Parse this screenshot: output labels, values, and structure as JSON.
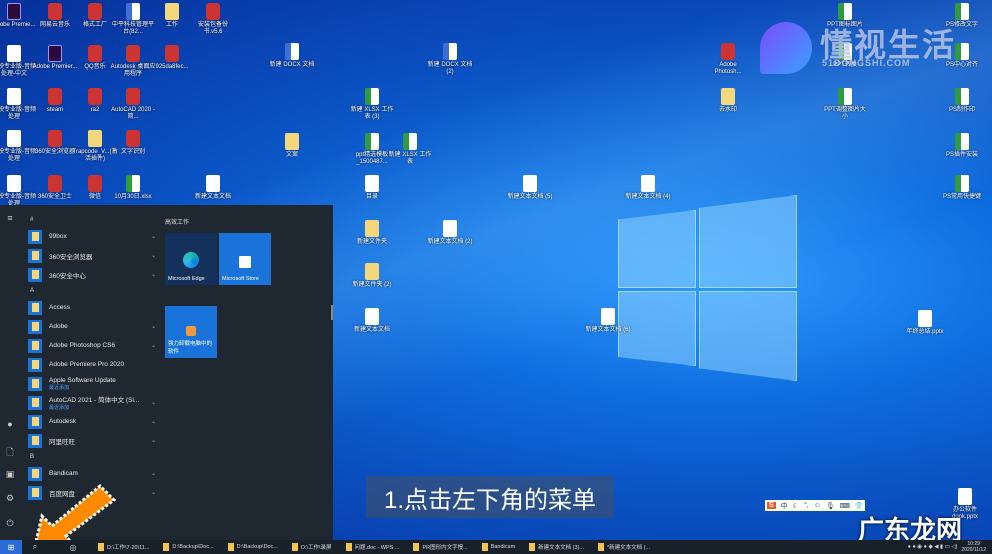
{
  "desktop": {
    "icons": [
      "Adobe Premie...",
      "网易云音乐",
      "格式工厂",
      "中平科技管理平台(82...",
      "工作",
      "安装包备份书.v5.6",
      "剪映专业版-音频处理-中文",
      "Adobe Premier...",
      "QQ音乐",
      "Autodesk 桌面应用程序",
      "925da8fec...",
      "剪映专业版-音频处理",
      "steam",
      "ra2",
      "AutoCAD 2020 - 简...",
      "剪映专业版-音频处理",
      "360安全浏览器",
      "Trapcode_V...(激活插件)",
      "文字识别",
      "剪映专业版-音频处理",
      "360安全卫士",
      "微信",
      "10月30日.xlsx",
      "新建文本文档",
      "新建 DOCX 文档",
      "新建 DOCX 文档 (2)",
      "新建 XLSX 工作表 (3)",
      "文案",
      "ppt精选模板_1500487...",
      "新建 XLSX 工作表",
      "目录",
      "新建文本文档 (5)",
      "新建文本文档 (4)",
      "新建文件夹",
      "新建文本文档 (2)",
      "新建文件夹 (2)",
      "新建文本文档",
      "新建文本文档 (6)",
      "Adobe Photosh...",
      "去水印",
      "PPT图标图片",
      "PPT转换",
      "PPT调整图片大小",
      "PS修改文字",
      "PS中心对齐",
      "PS制作印",
      "PS插件安装",
      "PS常用快捷键",
      "年终总结.pptx",
      "办公软件 dook.pptx"
    ]
  },
  "start_menu": {
    "groups": [
      {
        "header": "#",
        "items": [
          {
            "label": "99box",
            "chev": true
          },
          {
            "label": "360安全浏览器",
            "chev": true
          },
          {
            "label": "360安全中心",
            "chev": true
          }
        ]
      },
      {
        "header": "A",
        "items": [
          {
            "label": "Access"
          },
          {
            "label": "Adobe",
            "chev": true
          },
          {
            "label": "Adobe Photoshop CS6",
            "chev": true
          },
          {
            "label": "Adobe Premiere Pro 2020"
          },
          {
            "label": "Apple Software Update",
            "sub": "最近添加"
          },
          {
            "label": "AutoCAD 2021 - 简体中文 (Si...",
            "sub": "最近添加",
            "chev": true
          },
          {
            "label": "Autodesk",
            "chev": true
          },
          {
            "label": "阿里旺旺",
            "chev": true
          }
        ]
      },
      {
        "header": "B",
        "items": [
          {
            "label": "Bandicam",
            "chev": true
          },
          {
            "label": "百度网盘",
            "chev": true
          }
        ]
      }
    ],
    "tiles_header": "高效工作",
    "tiles": {
      "edge": "Microsoft Edge",
      "store": "Microsoft Store",
      "promo": "强力卸载电脑中的软件"
    }
  },
  "taskbar": {
    "items": [
      "D:\\工作\\7-20\\11...",
      "D:\\Backup\\Doc...",
      "D:\\Backup\\Doc...",
      "D:\\工作\\录屏",
      "问题.doc - WPS ...",
      "PR图形内文字慢...",
      "Bandicam",
      "新建文本文档 (3)...",
      "*新建文本文档 (..."
    ],
    "time": "10:29",
    "date": "2020/11/12"
  },
  "ime": {
    "label": "中"
  },
  "caption": "1.点击左下角的菜单",
  "watermarks": {
    "brand": "懂视生活",
    "domain": "51DONGSHI.COM",
    "bottom": "广东龙网"
  },
  "colors": {
    "accent": "#1a73d9",
    "arrow": "#ff8a00"
  }
}
